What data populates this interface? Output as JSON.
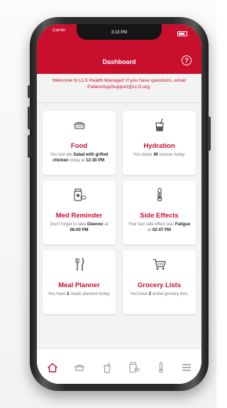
{
  "status_bar": {
    "carrier": "Carrier",
    "time": "3:13 PM"
  },
  "header": {
    "title": "Dashboard",
    "help_label": "?"
  },
  "welcome": "Welcome to LLS Health Manager! If you have questions, email PatientAppSupport@LLS.org.",
  "cards": {
    "food": {
      "icon": "food-container-icon",
      "title": "Food",
      "pre": "You last ate ",
      "bold1": "Salad with grilled chicken",
      "mid": " today at ",
      "bold2": "12:30 PM",
      "post": "."
    },
    "hydration": {
      "icon": "drinking-glass-icon",
      "title": "Hydration",
      "pre": "You drank ",
      "bold1": "40",
      "post": " ounces today."
    },
    "med": {
      "icon": "pill-bottle-icon",
      "title": "Med Reminder",
      "pre": "Don't forget to take ",
      "bold1": "Gleevec",
      "mid": " at ",
      "bold2": "06:00 PM"
    },
    "side": {
      "icon": "thermometer-icon",
      "title": "Side Effects",
      "pre": "Your last side effect was ",
      "bold1": "Fatigue",
      "mid": " at ",
      "bold2": "02:47 PM"
    },
    "meal": {
      "icon": "fork-knife-icon",
      "title": "Meal Planner",
      "pre": "You have ",
      "bold1": "2",
      "post": " meals planned today."
    },
    "grocery": {
      "icon": "shopping-cart-icon",
      "title": "Grocery Lists",
      "pre": "You have ",
      "bold1": "2",
      "post": " active grocery lists."
    }
  },
  "tabbar": [
    "home-icon",
    "food-icon",
    "hydration-icon",
    "medication-icon",
    "side-effects-icon",
    "menu-icon"
  ],
  "colors": {
    "brand_red": "#c8102e",
    "inactive_gray": "#9a9a9a",
    "background": "#f3f3f3"
  }
}
